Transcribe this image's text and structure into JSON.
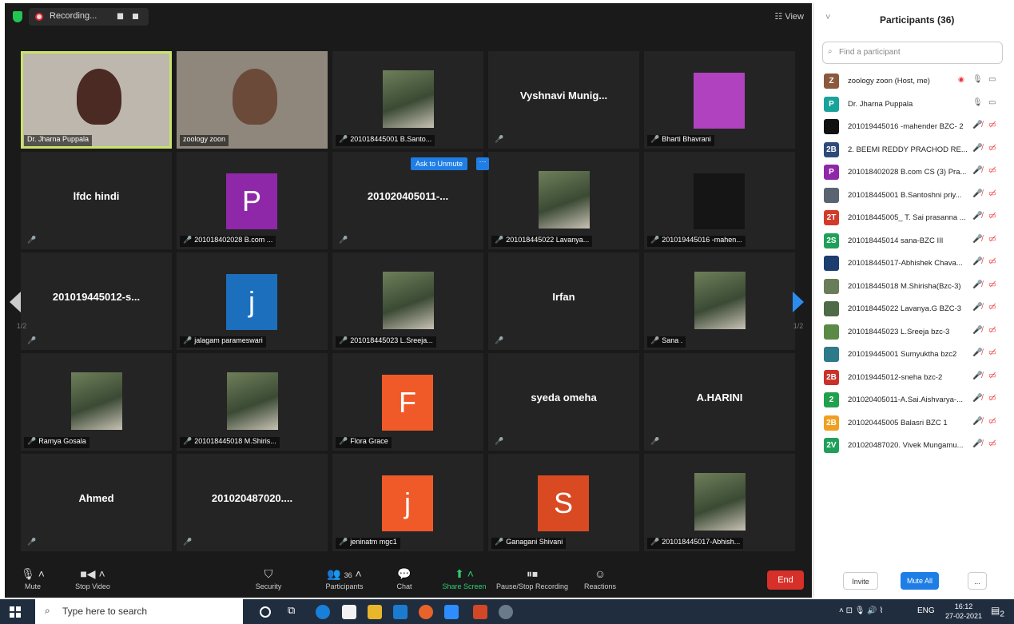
{
  "topbar": {
    "recording_label": "Recording...",
    "view_label": "View"
  },
  "tiles": [
    {
      "kind": "video",
      "caption": "Dr. Jharna Puppala",
      "muted": false
    },
    {
      "kind": "video",
      "caption": "zoology zoon",
      "muted": false
    },
    {
      "kind": "photo",
      "caption": "201018445001 B.Santo...",
      "muted": true
    },
    {
      "kind": "name",
      "big": "Vyshnavi  Munig...",
      "caption": "",
      "muted": true
    },
    {
      "kind": "letter",
      "letter": "",
      "color": "#b042c0",
      "caption": "Bharti Bhavrani",
      "muted": true
    },
    {
      "kind": "name",
      "big": "lfdc hindi",
      "caption": "",
      "muted": true
    },
    {
      "kind": "letter",
      "letter": "P",
      "color": "#8e28a8",
      "caption": "201018402028 B.com ...",
      "muted": true
    },
    {
      "kind": "name",
      "big": "201020405011-...",
      "caption": "",
      "muted": true
    },
    {
      "kind": "photo",
      "caption": "201018445022 Lavanya...",
      "muted": true
    },
    {
      "kind": "letter",
      "letter": "",
      "color": "#151515",
      "caption": "201019445016 -mahen...",
      "muted": true
    },
    {
      "kind": "name",
      "big": "201019445012-s...",
      "caption": "",
      "muted": true
    },
    {
      "kind": "letter",
      "letter": "j",
      "color": "#1b6fbd",
      "caption": "jalagam parameswari",
      "muted": true
    },
    {
      "kind": "photo",
      "caption": "201018445023 L.Sreeja...",
      "muted": true
    },
    {
      "kind": "name",
      "big": "Irfan",
      "caption": "",
      "muted": true
    },
    {
      "kind": "photo",
      "caption": "Sana .",
      "muted": true
    },
    {
      "kind": "photo",
      "caption": "Ramya Gosala",
      "muted": true
    },
    {
      "kind": "photo",
      "caption": "201018445018 M.Shiris...",
      "muted": true
    },
    {
      "kind": "letter",
      "letter": "F",
      "color": "#f05a28",
      "caption": "Flora Grace",
      "muted": true
    },
    {
      "kind": "name",
      "big": "syeda omeha",
      "caption": "",
      "muted": true
    },
    {
      "kind": "name",
      "big": "A.HARINI",
      "caption": "",
      "muted": true
    },
    {
      "kind": "name",
      "big": "Ahmed",
      "caption": "",
      "muted": true
    },
    {
      "kind": "name",
      "big": "201020487020....",
      "caption": "",
      "muted": true
    },
    {
      "kind": "letter",
      "letter": "j",
      "color": "#f05a28",
      "caption": "jeninatm mgc1",
      "muted": true
    },
    {
      "kind": "letter",
      "letter": "S",
      "color": "#d94a22",
      "caption": "Ganagani Shivani",
      "muted": true
    },
    {
      "kind": "photo",
      "caption": "201018445017-Abhish...",
      "muted": true
    }
  ],
  "ask_to_unmute": "Ask to Unmute",
  "ask_more": "···",
  "pager": {
    "left": "1/2",
    "right": "1/2"
  },
  "toolbar": {
    "mute": "Mute",
    "stop_video": "Stop Video",
    "security": "Security",
    "participants": "Participants",
    "participants_count": "36",
    "chat": "Chat",
    "share_screen": "Share Screen",
    "pause_recording": "Pause/Stop Recording",
    "reactions": "Reactions",
    "end": "End"
  },
  "panel": {
    "title": "Participants (36)",
    "search_placeholder": "Find a participant",
    "participants": [
      {
        "initials": "Z",
        "color": "#8b5a3c",
        "name": "zoology zoon (Host, me)",
        "host": true
      },
      {
        "initials": "P",
        "color": "#18a39a",
        "name": "Dr. Jharna Puppala",
        "host": false,
        "unmuted": true
      },
      {
        "initials": "",
        "color": "#111111",
        "name": "201019445016 -mahender BZC- 2"
      },
      {
        "initials": "2B",
        "color": "#2d4a7a",
        "name": "2. BEEMI  REDDY PRACHOD RE..."
      },
      {
        "initials": "P",
        "color": "#8e28a8",
        "name": "201018402028 B.com CS (3) Pra..."
      },
      {
        "initials": "",
        "color": "#5a6470",
        "name": "201018445001 B.Santoshni priy..."
      },
      {
        "initials": "2T",
        "color": "#d23b2a",
        "name": "201018445005_ T. Sai prasanna ..."
      },
      {
        "initials": "2S",
        "color": "#1fa05a",
        "name": "201018445014 sana-BZC III"
      },
      {
        "initials": "",
        "color": "#1c3d6e",
        "name": "201018445017-Abhishek Chava..."
      },
      {
        "initials": "",
        "color": "#6a7d5a",
        "name": "201018445018 M.Shirisha(Bzc-3)"
      },
      {
        "initials": "",
        "color": "#4d6b47",
        "name": "201018445022 Lavanya.G BZC-3"
      },
      {
        "initials": "",
        "color": "#5b8a46",
        "name": "201018445023 L.Sreeja bzc-3"
      },
      {
        "initials": "",
        "color": "#2c7a8a",
        "name": "201019445001 Sumyuktha  bzc2"
      },
      {
        "initials": "2B",
        "color": "#c9322a",
        "name": "201019445012-sneha bzc-2"
      },
      {
        "initials": "2",
        "color": "#21a04e",
        "name": "201020405011-A.Sai.Aishvarya-..."
      },
      {
        "initials": "2B",
        "color": "#f0a020",
        "name": "201020445005 Balasri BZC 1"
      },
      {
        "initials": "2V",
        "color": "#1fa05a",
        "name": "201020487020. Vivek Mungamu..."
      }
    ],
    "invite": "Invite",
    "mute_all": "Mute All",
    "more": "..."
  },
  "taskbar": {
    "search_text": "Type here to search",
    "lang": "ENG",
    "time": "16:12",
    "date": "27-02-2021",
    "notif_count": "2"
  }
}
